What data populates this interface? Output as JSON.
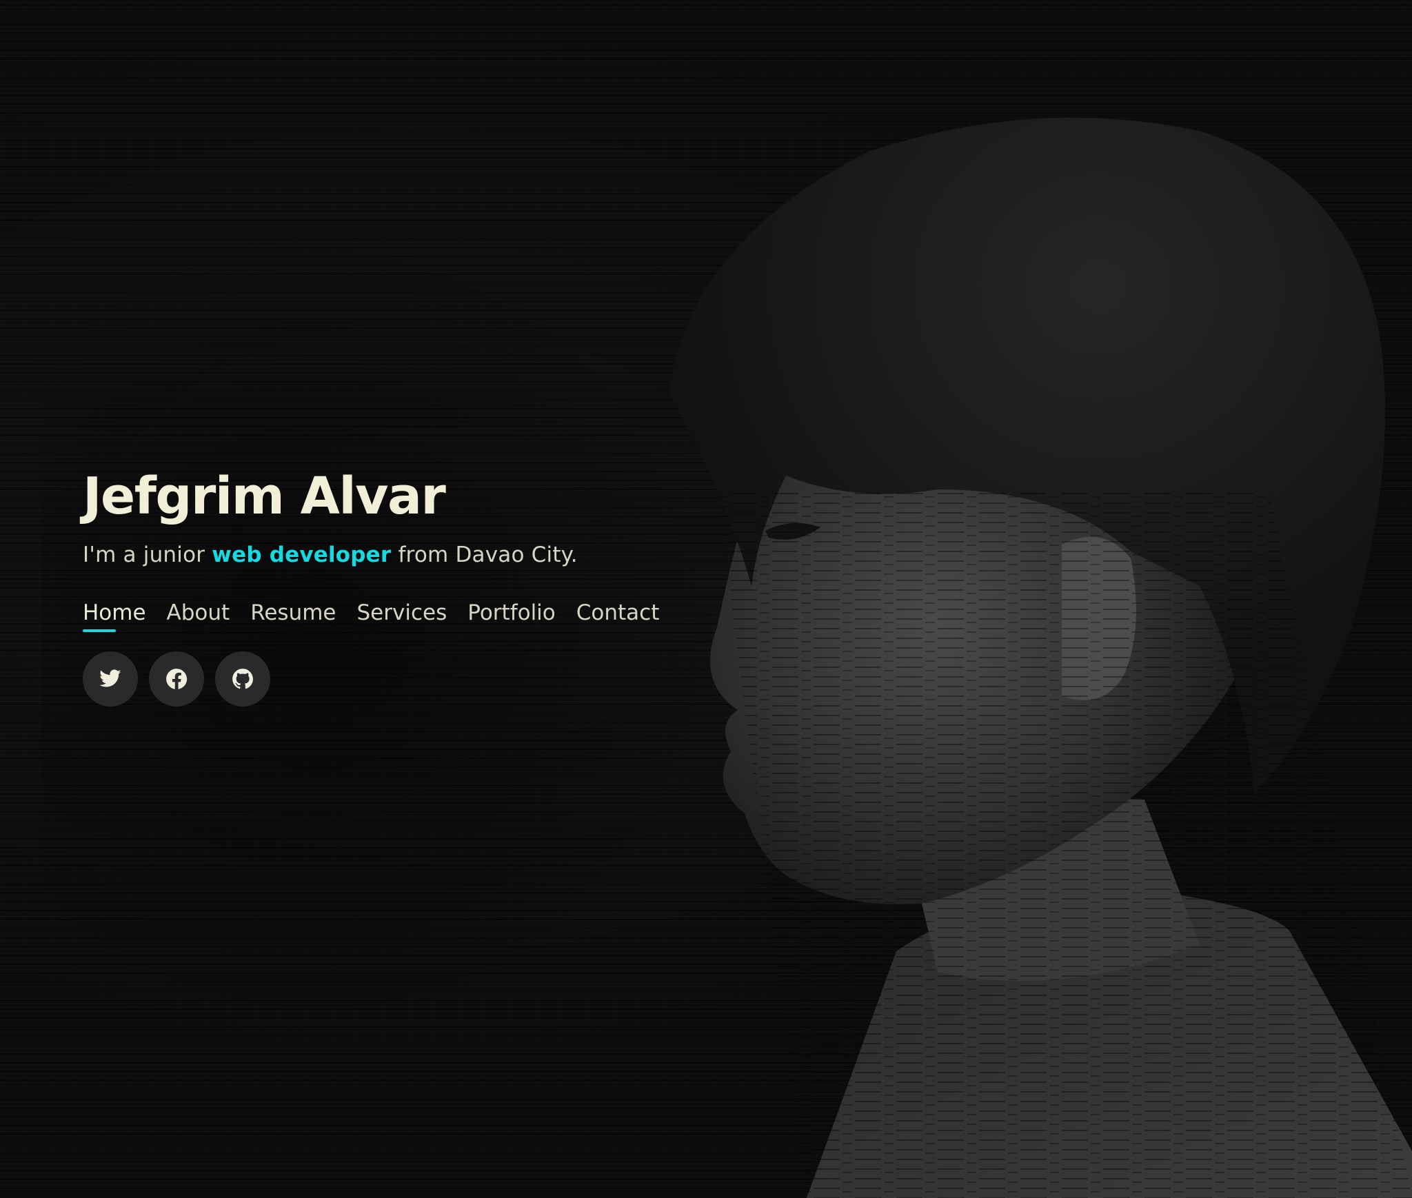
{
  "hero": {
    "name": "Jefgrim Alvar",
    "subtitle_prefix": "I'm a junior ",
    "subtitle_highlight": "web developer",
    "subtitle_suffix": " from Davao City."
  },
  "nav": {
    "items": [
      {
        "label": "Home",
        "active": true
      },
      {
        "label": "About",
        "active": false
      },
      {
        "label": "Resume",
        "active": false
      },
      {
        "label": "Services",
        "active": false
      },
      {
        "label": "Portfolio",
        "active": false
      },
      {
        "label": "Contact",
        "active": false
      }
    ]
  },
  "socials": [
    {
      "icon": "twitter-icon"
    },
    {
      "icon": "facebook-icon"
    },
    {
      "icon": "github-icon"
    }
  ],
  "colors": {
    "accent": "#18d9e0",
    "background": "#0c0c0d",
    "text": "#d8d5c4",
    "heading": "#f2efd8",
    "social_bg": "#2a2a2b"
  }
}
